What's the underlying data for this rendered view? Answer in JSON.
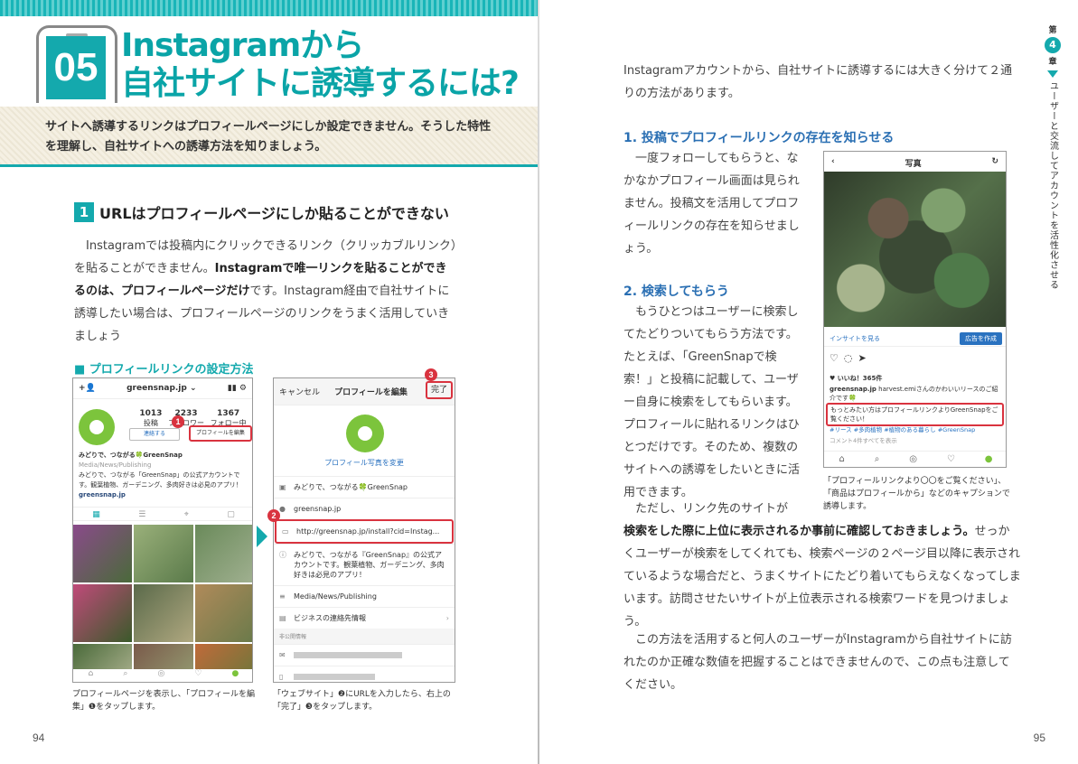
{
  "left": {
    "chapter_number": "05",
    "title_line1": "Instagramから",
    "title_line2": "自社サイトに誘導するには?",
    "summary": "サイトへ誘導するリンクはプロフィールページにしか設定できません。そうした特性を理解し、自社サイトへの誘導方法を知りましょう。",
    "section_number": "1",
    "section_title": "URLはプロフィールページにしか貼ることができない",
    "para_a": "Instagramでは投稿内にクリックできるリンク（クリッカブルリンク）を貼ることができません。",
    "para_bold": "Instagramで唯一リンクを貼ることができるのは、プロフィールページだけ",
    "para_b": "です。Instagram経由で自社サイトに誘導したい場合は、プロフィールページのリンクをうまく活用していきましょう",
    "figure_label": "■ プロフィールリンクの設定方法",
    "caption1": "プロフィールページを表示し、「プロフィールを編集」❶をタップします。",
    "caption2": "「ウェブサイト」❷にURLを入力したら、右上の「完了」❸をタップします。",
    "page_number": "94"
  },
  "shot1": {
    "username": "greensnap.jp ⌄",
    "stats": [
      {
        "num": "1013",
        "label": "投稿"
      },
      {
        "num": "2233",
        "label": "フォロワー"
      },
      {
        "num": "1367",
        "label": "フォロー中"
      }
    ],
    "contact_btn": "連絡する",
    "edit_btn": "プロフィールを編集",
    "bio_name": "みどりで、つながる🍀GreenSnap",
    "bio_category": "Media/News/Publishing",
    "bio_text": "みどりで、つながる「GreenSnap」の公式アカウントです。観葉植物、ガーデニング、多肉好きは必見のアプリ！",
    "bio_link": "greensnap.jp"
  },
  "shot2": {
    "cancel": "キャンセル",
    "header": "プロフィールを編集",
    "done": "完了",
    "change_photo": "プロフィール写真を変更",
    "rows": [
      {
        "icon": "▣",
        "text": "みどりで、つながる🍀GreenSnap"
      },
      {
        "icon": "●",
        "text": "greensnap.jp"
      },
      {
        "icon": "▭",
        "text": "http://greensnap.jp/install?cid=Instag..."
      },
      {
        "icon": "ⓘ",
        "text": "みどりで、つながる『GreenSnap』の公式アカウントです。観葉植物、ガーデニング、多肉好きは必見のアプリ！"
      },
      {
        "icon": "≡",
        "text": "Media/News/Publishing"
      },
      {
        "icon": "▤",
        "text": "ビジネスの連絡先情報"
      }
    ],
    "private_label": "非公開情報"
  },
  "right": {
    "intro": "Instagramアカウントから、自社サイトに誘導するには大きく分けて２通りの方法があります。",
    "h1": "1. 投稿でプロフィールリンクの存在を知らせる",
    "p1": "一度フォローしてもらうと、なかなかプロフィール画面は見られません。投稿文を活用してプロフィールリンクの存在を知らせましょう。",
    "h2": "2. 検索してもらう",
    "p2": "もうひとつはユーザーに検索してたどりついてもらう方法です。たとえば、「GreenSnapで検索！」と投稿に記載して、ユーザー自身に検索をしてもらいます。プロフィールに貼れるリンクはひとつだけです。そのため、複数のサイトへの誘導をしたいときに活用できます。",
    "p3_a": "ただし、リンク先のサイトが",
    "p3_bold": "検索をした際に上位に表示されるか事前に確認しておきましょう。",
    "p3_b": "せっかくユーザーが検索をしてくれても、検索ページの２ページ目以降に表示されているような場合だと、うまくサイトにたどり着いてもらえなくなってしまいます。訪問させたいサイトが上位表示される検索ワードを見つけましょう。",
    "p4": "この方法を活用すると何人のユーザーがInstagramから自社サイトに訪れたのか正確な数値を把握することはできませんので、この点も注意してください。",
    "caption": "「プロフィールリンクより〇〇をご覧ください」、「商品はプロフィールから」などのキャプションで誘導します。",
    "page_number": "95",
    "side_chapter_pre": "第",
    "side_chapter_num": "4",
    "side_chapter_post": "章",
    "side_text": "ユーザーと交流してアカウントを活性化させる"
  },
  "shot3": {
    "header": "写真",
    "insight": "インサイトを見る",
    "promote": "広告を作成",
    "likes": "♥ いいね！365件",
    "caption_user": "greensnap.jp",
    "caption_text": "harvest.emiさんのかわいいリースのご紹介です🍀",
    "highlight": "もっとみたい方はプロフィールリンクよりGreenSnapをご覧ください！",
    "tags": "#リース #多肉植物 #植物のある暮らし #GreenSnap",
    "comments": "コメント4件すべてを表示"
  }
}
